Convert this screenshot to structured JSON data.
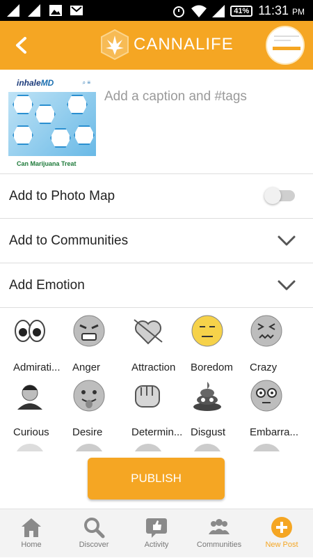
{
  "status_bar": {
    "battery": "41%",
    "time": "11:31",
    "ampm": "PM"
  },
  "header": {
    "title": "CANNALIFE",
    "back_icon": "back-chevron-icon"
  },
  "post": {
    "thumbnail_brand_a": "inhale",
    "thumbnail_brand_b": "MD",
    "thumbnail_title": "Can Marijuana Treat",
    "caption_placeholder": "Add a caption and #tags"
  },
  "options": {
    "photo_map_label": "Add to Photo Map",
    "photo_map_enabled": false,
    "communities_label": "Add to Communities",
    "emotion_label": "Add Emotion"
  },
  "emotions": [
    {
      "label": "Admirati...",
      "icon": "eyes-icon"
    },
    {
      "label": "Anger",
      "icon": "angry-face-icon"
    },
    {
      "label": "Attraction",
      "icon": "heart-arrow-icon"
    },
    {
      "label": "Boredom",
      "icon": "neutral-face-icon"
    },
    {
      "label": "Crazy",
      "icon": "confounded-face-icon"
    },
    {
      "label": "Curious",
      "icon": "curious-person-icon"
    },
    {
      "label": "Desire",
      "icon": "tongue-face-icon"
    },
    {
      "label": "Determin...",
      "icon": "fist-icon"
    },
    {
      "label": "Disgust",
      "icon": "poop-icon"
    },
    {
      "label": "Embarra...",
      "icon": "flushed-face-icon"
    }
  ],
  "publish_label": "PUBLISH",
  "nav": [
    {
      "label": "Home",
      "icon": "home-icon"
    },
    {
      "label": "Discover",
      "icon": "search-icon"
    },
    {
      "label": "Activity",
      "icon": "activity-thumbs-up-icon"
    },
    {
      "label": "Communities",
      "icon": "people-icon"
    },
    {
      "label": "New Post",
      "icon": "plus-circle-icon"
    }
  ],
  "colors": {
    "accent": "#f5a623",
    "nav_inactive": "#777777",
    "text": "#222222"
  }
}
